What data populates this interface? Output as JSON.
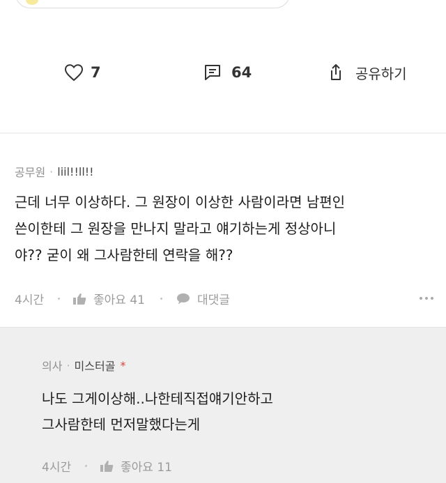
{
  "post": {
    "actions": {
      "like_count": "7",
      "comment_count": "64",
      "share_label": "공유하기"
    }
  },
  "comments": [
    {
      "job": "공무원",
      "author": "liil!!ll!!",
      "lines": [
        "근데 너무 이상하다. 그 원장이 이상한 사람이라면 남편인",
        "쓴이한테 그 원장을 만나지 말라고 얘기하는게 정상아니",
        "야?? 굳이 왜 그사람한테 연락을 해??"
      ],
      "time": "4시간",
      "like_label": "좋아요 41",
      "reply_label": "대댓글"
    }
  ],
  "reply": {
    "job": "의사",
    "author": "미스터골",
    "author_mark": "*",
    "lines": [
      "나도 그게이상해..나한테직접얘기안하고",
      "그사람한테 먼저말했다는게"
    ],
    "time": "4시간",
    "like_label": "좋아요 11"
  },
  "colors": {
    "accent_mark": "#e0453a",
    "reply_background": "#efefef",
    "muted_text": "#8f8f8f"
  }
}
